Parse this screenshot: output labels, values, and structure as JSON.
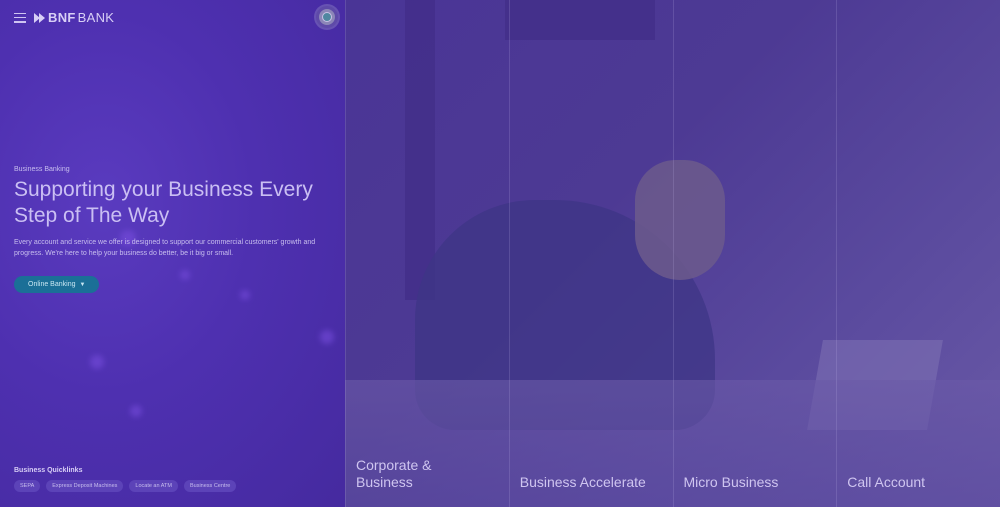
{
  "brand": {
    "bold": "BNF",
    "rest": "BANK"
  },
  "hero": {
    "eyebrow": "Business Banking",
    "title": "Supporting your Business Every Step of The Way",
    "description": "Every account and service we offer is designed to support our commercial customers' growth and progress. We're here to help your business do better, be it big or small.",
    "cta_label": "Online Banking"
  },
  "quicklinks": {
    "title": "Business Quicklinks",
    "items": [
      "SEPA",
      "Express Deposit Machines",
      "Locate an ATM",
      "Business Centre"
    ]
  },
  "products": [
    {
      "label": "Corporate & Business"
    },
    {
      "label": "Business Accelerate"
    },
    {
      "label": "Micro Business"
    },
    {
      "label": "Call Account"
    }
  ],
  "icons": {
    "menu": "menu-icon",
    "logo": "bnf-logo-icon",
    "cta_chevron": "chevron-down-icon",
    "profile": "avatar"
  },
  "colors": {
    "overlay": "#4a2fa6",
    "cta_background": "#1b6f97",
    "text": "#cabff3"
  }
}
